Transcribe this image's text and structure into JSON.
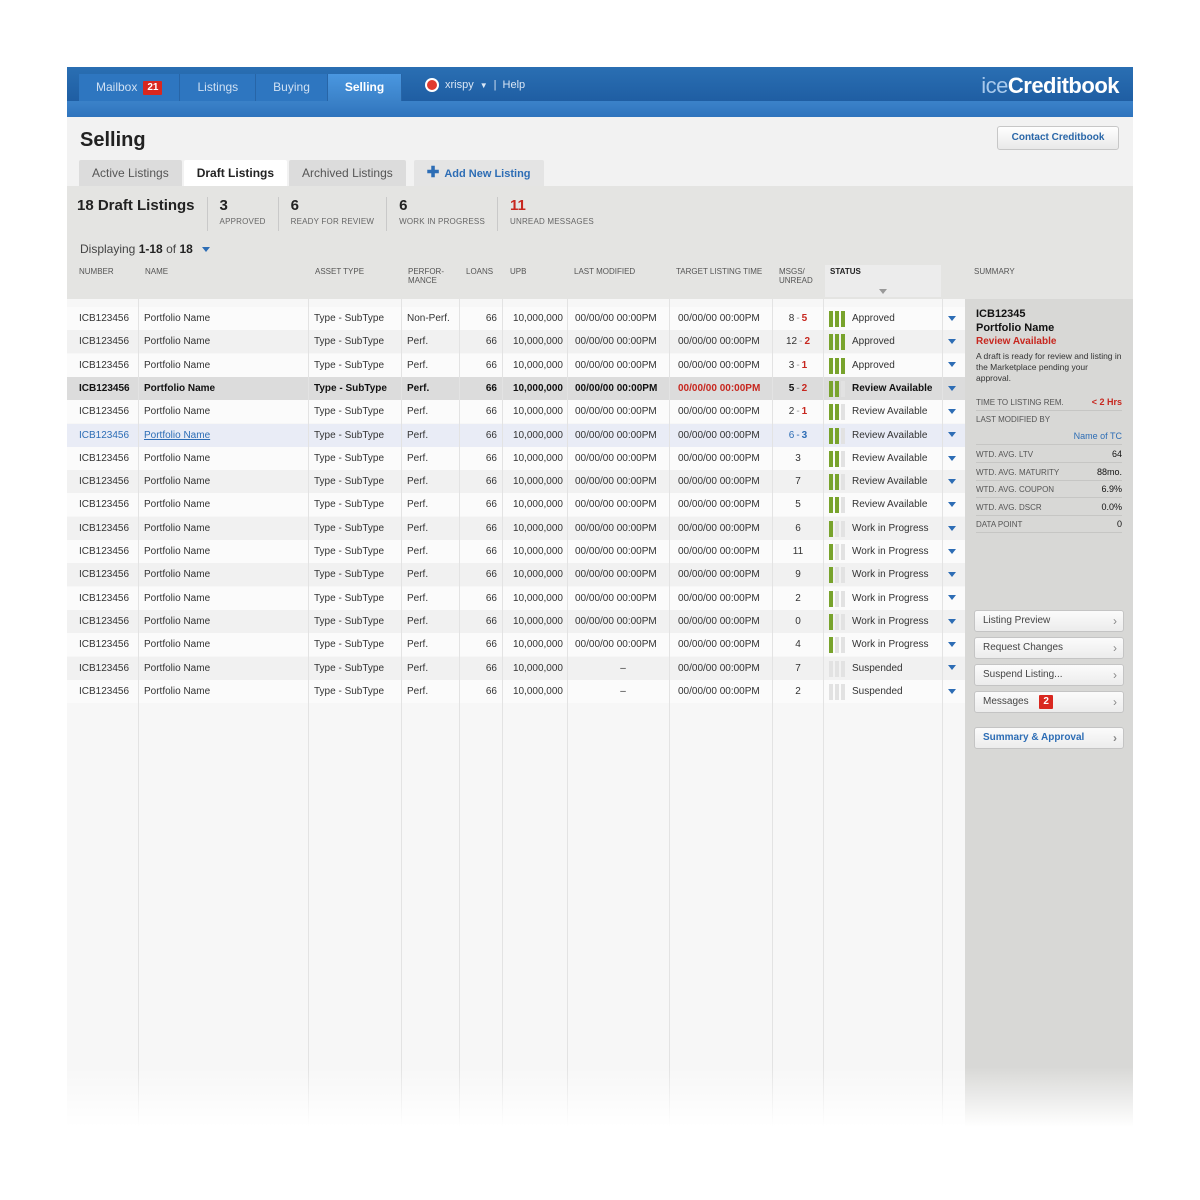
{
  "nav": {
    "tabs": [
      {
        "label": "Mailbox",
        "badge": "21"
      },
      {
        "label": "Listings"
      },
      {
        "label": "Buying"
      },
      {
        "label": "Selling"
      }
    ],
    "user": "xrispy",
    "help": "Help",
    "logo_prefix": "ice",
    "logo_name": "Creditbook"
  },
  "page": {
    "title": "Selling",
    "contact_label": "Contact Creditbook",
    "subtabs": [
      "Active Listings",
      "Draft Listings",
      "Archived Listings"
    ],
    "add_label": "Add New Listing"
  },
  "stats": {
    "title": "18 Draft Listings",
    "items": [
      {
        "value": "3",
        "label": "APPROVED"
      },
      {
        "value": "6",
        "label": "READY FOR REVIEW"
      },
      {
        "value": "6",
        "label": "WORK IN PROGRESS"
      },
      {
        "value": "11",
        "label": "UNREAD MESSAGES"
      }
    ]
  },
  "displaying": {
    "prefix": "Displaying",
    "range": "1-18",
    "of": "of",
    "total": "18"
  },
  "columns": {
    "number": "NUMBER",
    "name": "NAME",
    "asset": "ASSET TYPE",
    "perf1": "PERFOR-",
    "perf2": "MANCE",
    "loans": "LOANS",
    "upb": "UPB",
    "modified": "LAST MODIFIED",
    "target": "TARGET LISTING TIME",
    "msgs1": "MSGS/",
    "msgs2": "UNREAD",
    "status": "STATUS",
    "summary": "SUMMARY"
  },
  "rows": [
    {
      "num": "ICB123456",
      "name": "Portfolio Name",
      "asset": "Type - SubType",
      "perf": "Non-Perf.",
      "loans": "66",
      "upb": "10,000,000",
      "mod": "00/00/00 00:00PM",
      "target": "00/00/00 00:00PM",
      "msgs": "8",
      "unread": "5",
      "bars": 3,
      "status": "Approved"
    },
    {
      "num": "ICB123456",
      "name": "Portfolio Name",
      "asset": "Type - SubType",
      "perf": "Perf.",
      "loans": "66",
      "upb": "10,000,000",
      "mod": "00/00/00 00:00PM",
      "target": "00/00/00 00:00PM",
      "msgs": "12",
      "unread": "2",
      "bars": 3,
      "status": "Approved"
    },
    {
      "num": "ICB123456",
      "name": "Portfolio Name",
      "asset": "Type - SubType",
      "perf": "Perf.",
      "loans": "66",
      "upb": "10,000,000",
      "mod": "00/00/00 00:00PM",
      "target": "00/00/00 00:00PM",
      "msgs": "3",
      "unread": "1",
      "bars": 3,
      "status": "Approved"
    },
    {
      "num": "ICB123456",
      "name": "Portfolio Name",
      "asset": "Type - SubType",
      "perf": "Perf.",
      "loans": "66",
      "upb": "10,000,000",
      "mod": "00/00/00 00:00PM",
      "target": "00/00/00 00:00PM",
      "msgs": "5",
      "unread": "2",
      "bars": 2,
      "status": "Review Available"
    },
    {
      "num": "ICB123456",
      "name": "Portfolio Name",
      "asset": "Type - SubType",
      "perf": "Perf.",
      "loans": "66",
      "upb": "10,000,000",
      "mod": "00/00/00 00:00PM",
      "target": "00/00/00 00:00PM",
      "msgs": "2",
      "unread": "1",
      "bars": 2,
      "status": "Review Available"
    },
    {
      "num": "ICB123456",
      "name": "Portfolio Name",
      "asset": "Type - SubType",
      "perf": "Perf.",
      "loans": "66",
      "upb": "10,000,000",
      "mod": "00/00/00 00:00PM",
      "target": "00/00/00 00:00PM",
      "msgs": "6",
      "unread": "3",
      "bars": 2,
      "status": "Review Available"
    },
    {
      "num": "ICB123456",
      "name": "Portfolio Name",
      "asset": "Type - SubType",
      "perf": "Perf.",
      "loans": "66",
      "upb": "10,000,000",
      "mod": "00/00/00 00:00PM",
      "target": "00/00/00 00:00PM",
      "msgs": "3",
      "unread": "",
      "bars": 2,
      "status": "Review Available"
    },
    {
      "num": "ICB123456",
      "name": "Portfolio Name",
      "asset": "Type - SubType",
      "perf": "Perf.",
      "loans": "66",
      "upb": "10,000,000",
      "mod": "00/00/00 00:00PM",
      "target": "00/00/00 00:00PM",
      "msgs": "7",
      "unread": "",
      "bars": 2,
      "status": "Review Available"
    },
    {
      "num": "ICB123456",
      "name": "Portfolio Name",
      "asset": "Type - SubType",
      "perf": "Perf.",
      "loans": "66",
      "upb": "10,000,000",
      "mod": "00/00/00 00:00PM",
      "target": "00/00/00 00:00PM",
      "msgs": "5",
      "unread": "",
      "bars": 2,
      "status": "Review Available"
    },
    {
      "num": "ICB123456",
      "name": "Portfolio Name",
      "asset": "Type - SubType",
      "perf": "Perf.",
      "loans": "66",
      "upb": "10,000,000",
      "mod": "00/00/00 00:00PM",
      "target": "00/00/00 00:00PM",
      "msgs": "6",
      "unread": "",
      "bars": 1,
      "status": "Work in Progress"
    },
    {
      "num": "ICB123456",
      "name": "Portfolio Name",
      "asset": "Type - SubType",
      "perf": "Perf.",
      "loans": "66",
      "upb": "10,000,000",
      "mod": "00/00/00 00:00PM",
      "target": "00/00/00 00:00PM",
      "msgs": "11",
      "unread": "",
      "bars": 1,
      "status": "Work in Progress"
    },
    {
      "num": "ICB123456",
      "name": "Portfolio Name",
      "asset": "Type - SubType",
      "perf": "Perf.",
      "loans": "66",
      "upb": "10,000,000",
      "mod": "00/00/00 00:00PM",
      "target": "00/00/00 00:00PM",
      "msgs": "9",
      "unread": "",
      "bars": 1,
      "status": "Work in Progress"
    },
    {
      "num": "ICB123456",
      "name": "Portfolio Name",
      "asset": "Type - SubType",
      "perf": "Perf.",
      "loans": "66",
      "upb": "10,000,000",
      "mod": "00/00/00 00:00PM",
      "target": "00/00/00 00:00PM",
      "msgs": "2",
      "unread": "",
      "bars": 1,
      "status": "Work in Progress"
    },
    {
      "num": "ICB123456",
      "name": "Portfolio Name",
      "asset": "Type - SubType",
      "perf": "Perf.",
      "loans": "66",
      "upb": "10,000,000",
      "mod": "00/00/00 00:00PM",
      "target": "00/00/00 00:00PM",
      "msgs": "0",
      "unread": "",
      "bars": 1,
      "status": "Work in Progress"
    },
    {
      "num": "ICB123456",
      "name": "Portfolio Name",
      "asset": "Type - SubType",
      "perf": "Perf.",
      "loans": "66",
      "upb": "10,000,000",
      "mod": "00/00/00 00:00PM",
      "target": "00/00/00 00:00PM",
      "msgs": "4",
      "unread": "",
      "bars": 1,
      "status": "Work in Progress"
    },
    {
      "num": "ICB123456",
      "name": "Portfolio Name",
      "asset": "Type - SubType",
      "perf": "Perf.",
      "loans": "66",
      "upb": "10,000,000",
      "mod": "–",
      "target": "00/00/00 00:00PM",
      "msgs": "7",
      "unread": "",
      "bars": 0,
      "status": "Suspended"
    },
    {
      "num": "ICB123456",
      "name": "Portfolio Name",
      "asset": "Type - SubType",
      "perf": "Perf.",
      "loans": "66",
      "upb": "10,000,000",
      "mod": "–",
      "target": "00/00/00 00:00PM",
      "msgs": "2",
      "unread": "",
      "bars": 0,
      "status": "Suspended"
    }
  ],
  "summary": {
    "id": "ICB12345",
    "name": "Portfolio Name",
    "status": "Review Available",
    "description": "A draft is ready for review and listing in the Marketplace pending your approval.",
    "time_label": "TIME TO LISTING REM.",
    "time_value": "< 2 Hrs",
    "modified_by_label": "LAST MODIFIED BY",
    "modified_by_value": "Name of TC",
    "metrics": [
      {
        "label": "WTD. AVG. LTV",
        "value": "64"
      },
      {
        "label": "WTD. AVG. MATURITY",
        "value": "88mo."
      },
      {
        "label": "WTD. AVG. COUPON",
        "value": "6.9%"
      },
      {
        "label": "WTD. AVG. DSCR",
        "value": "0.0%"
      },
      {
        "label": "DATA POINT",
        "value": "0"
      }
    ],
    "actions": [
      "Listing Preview",
      "Request Changes",
      "Suspend Listing...",
      "Messages"
    ],
    "messages_badge": "2",
    "primary_action": "Summary & Approval"
  },
  "colors": {
    "accent": "#2d6db5",
    "alert": "#c7271f",
    "progress": "#78a32c",
    "topbar": "#2a6fb3"
  }
}
